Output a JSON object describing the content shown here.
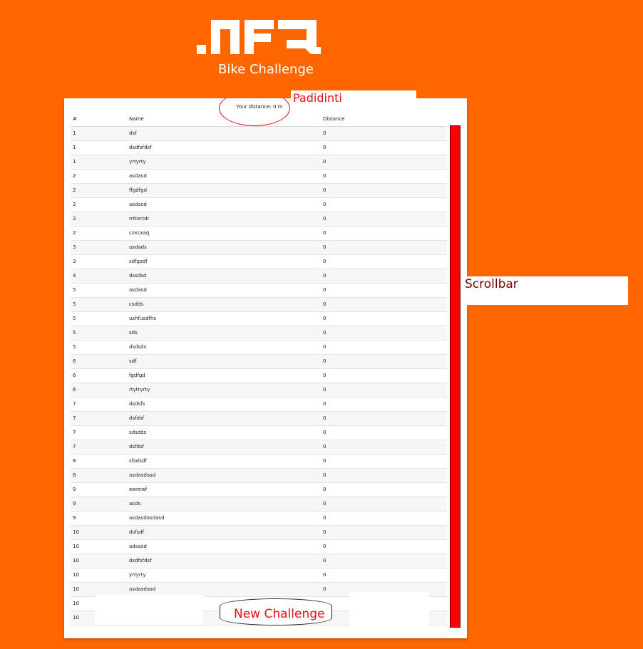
{
  "logo": {
    "brand": ".NFQ",
    "icon": "nfq-logo-icon"
  },
  "header": {
    "subtitle": "Bike Challenge"
  },
  "panel": {
    "your_distance": "Your distance: 0 m"
  },
  "table": {
    "columns": [
      "#",
      "Name",
      "Distance"
    ],
    "rows": [
      [
        "1",
        "dsf",
        "0"
      ],
      [
        "1",
        "dsdfsfdsf",
        "0"
      ],
      [
        "1",
        "yrtyrty",
        "0"
      ],
      [
        "2",
        "asdasd",
        "0"
      ],
      [
        "2",
        "ffgdfgd",
        "0"
      ],
      [
        "2",
        "asdasd",
        "0"
      ],
      [
        "2",
        "rrttertdr",
        "0"
      ],
      [
        "2",
        "czxcxaq",
        "0"
      ],
      [
        "3",
        "asdads",
        "0"
      ],
      [
        "3",
        "sdfgsdf",
        "0"
      ],
      [
        "4",
        "dssdsd",
        "0"
      ],
      [
        "5",
        "asdasd",
        "0"
      ],
      [
        "5",
        "csdds",
        "0"
      ],
      [
        "5",
        "ushfusdfhs",
        "0"
      ],
      [
        "5",
        "sds",
        "0"
      ],
      [
        "5",
        "dsdsds",
        "0"
      ],
      [
        "6",
        "sdf",
        "0"
      ],
      [
        "6",
        "fgdfgd",
        "0"
      ],
      [
        "6",
        "rtytryrty",
        "0"
      ],
      [
        "7",
        "dsdsfs",
        "0"
      ],
      [
        "7",
        "dsfdsf",
        "0"
      ],
      [
        "7",
        "sdsdds",
        "0"
      ],
      [
        "7",
        "dsfdsf",
        "0"
      ],
      [
        "8",
        "sfsdsdf",
        "0"
      ],
      [
        "8",
        "asdasdasd",
        "0"
      ],
      [
        "9",
        "ewrewf",
        "0"
      ],
      [
        "9",
        "asds",
        "0"
      ],
      [
        "9",
        "asdasdasdasd",
        "0"
      ],
      [
        "10",
        "dsfsdf",
        "0"
      ],
      [
        "10",
        "adsasd",
        "0"
      ],
      [
        "10",
        "dsdfsfdsf",
        "0"
      ],
      [
        "10",
        "yrtyrty",
        "0"
      ],
      [
        "10",
        "asdasdasd",
        "0"
      ],
      [
        "10",
        "",
        ""
      ],
      [
        "10",
        "",
        ""
      ]
    ]
  },
  "annotations": {
    "padidinti": "Padidinti",
    "scrollbar": "Scrollbar",
    "new_challenge": "New Challenge"
  },
  "colors": {
    "background": "#ff6600",
    "annotation_red": "#e3101a",
    "scrollbar": "#ff0000",
    "scrollbar_label": "#7a0000"
  }
}
